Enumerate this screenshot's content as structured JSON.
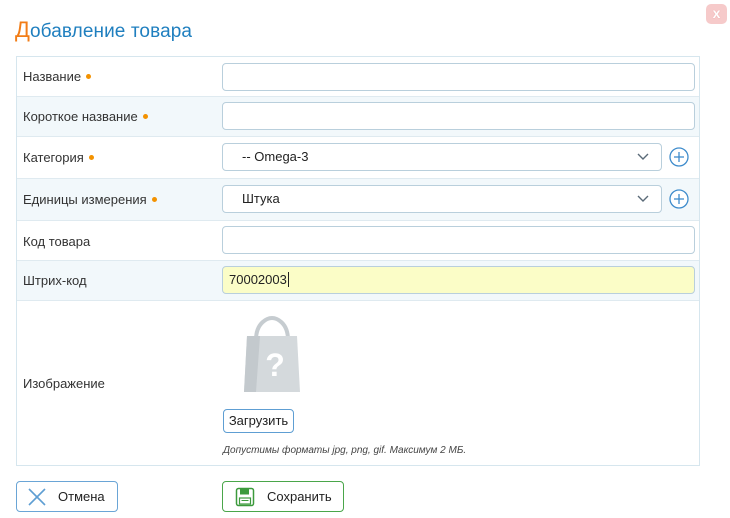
{
  "dialog": {
    "title_first": "Д",
    "title_rest": "обавление товара",
    "close_label": "x"
  },
  "fields": {
    "name": {
      "label": "Название",
      "value": ""
    },
    "short_name": {
      "label": "Короткое название",
      "value": ""
    },
    "category": {
      "label": "Категория",
      "value": "-- Omega-3"
    },
    "units": {
      "label": "Единицы измерения",
      "value": "Штука"
    },
    "code": {
      "label": "Код товара",
      "value": ""
    },
    "barcode": {
      "label": "Штрих-код",
      "value": "70002003"
    },
    "image": {
      "label": "Изображение",
      "upload_label": "Загрузить",
      "hint": "Допустимы форматы jpg, png, gif. Максимум 2 МБ."
    }
  },
  "actions": {
    "cancel_label": "Отмена",
    "save_label": "Сохранить"
  },
  "colors": {
    "title": "#1f7fbf",
    "title_accent": "#f27d17",
    "required_dot": "#f39200",
    "barcode_highlight": "#fbfdc7",
    "save_icon": "#3c9a3c",
    "cancel_icon": "#5e9ed3"
  },
  "icons": {
    "close": "close-icon",
    "chevron": "chevron-down-icon",
    "add": "plus-circle-icon",
    "placeholder": "shopping-bag-question-icon",
    "cancel": "x-icon",
    "save": "floppy-disk-icon"
  }
}
